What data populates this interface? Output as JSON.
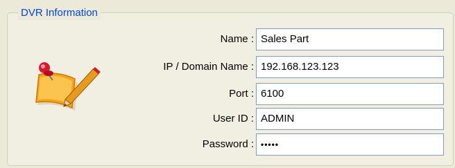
{
  "group": {
    "title": "DVR Information"
  },
  "fields": [
    {
      "label": "Name :",
      "value": "Sales Part"
    },
    {
      "label": "IP / Domain Name :",
      "value": "192.168.123.123"
    },
    {
      "label": "Port :",
      "value": "6100"
    },
    {
      "label": "User ID :",
      "value": "ADMIN"
    },
    {
      "label": "Password :",
      "value": "•••••"
    }
  ],
  "icons": {
    "dvr_info": "memo-pencil-icon"
  },
  "colors": {
    "background": "#ECE9D8",
    "group_title": "#0046D5",
    "input_border": "#7F9DB9"
  }
}
